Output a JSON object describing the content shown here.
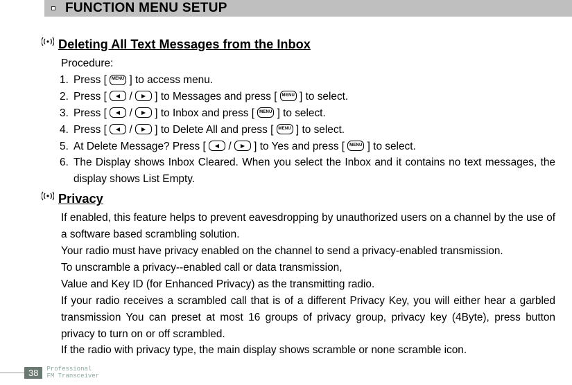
{
  "header": {
    "title": "FUNCTION MENU SETUP"
  },
  "section1": {
    "title": "Deleting All Text Messages from the Inbox",
    "procedure_label": "Procedure:",
    "steps": {
      "s1a": "Press [ ",
      "s1b": " ] to access menu.",
      "s2a": "Press [ ",
      "s2b": " / ",
      "s2c": " ] to Messages and press [ ",
      "s2d": " ] to select.",
      "s3a": "Press [ ",
      "s3b": " / ",
      "s3c": " ] to Inbox and press [ ",
      "s3d": " ] to select.",
      "s4a": "Press [ ",
      "s4b": " / ",
      "s4c": " ] to Delete All and press [ ",
      "s4d": " ] to select.",
      "s5a": "At Delete Message? Press [ ",
      "s5b": " / ",
      "s5c": " ] to Yes and press [ ",
      "s5d": " ] to select.",
      "s6": "The Display shows Inbox Cleared. When you select the Inbox and it contains no text messages, the display shows List Empty."
    }
  },
  "section2": {
    "title": "Privacy",
    "p1": "If enabled, this feature helps to prevent eavesdropping by unauthorized users on a channel  by the use of a software based scrambling solution.",
    "p2": "Your radio must have privacy enabled on the channel to send a privacy-enabled transmission.",
    "p3": "To  unscramble  a  privacy--enabled  call  or  data transmission,",
    "p4": "Value  and  Key  ID  (for  Enhanced  Privacy)  as  the transmitting radio.",
    "p5": "If your radio receives a scrambled call that is of a different Privacy Key, you will either hear a garbled transmission  You can preset at most 16 groups of privacy group, privacy key (4Byte), press button privacy to turn on or off scrambled.",
    "p6": "If the radio with privacy type, the main display shows scramble or none scramble icon."
  },
  "buttons": {
    "menu": "MENU"
  },
  "footer": {
    "page": "38",
    "line1": "Professional",
    "line2": "FM Transceiver"
  }
}
